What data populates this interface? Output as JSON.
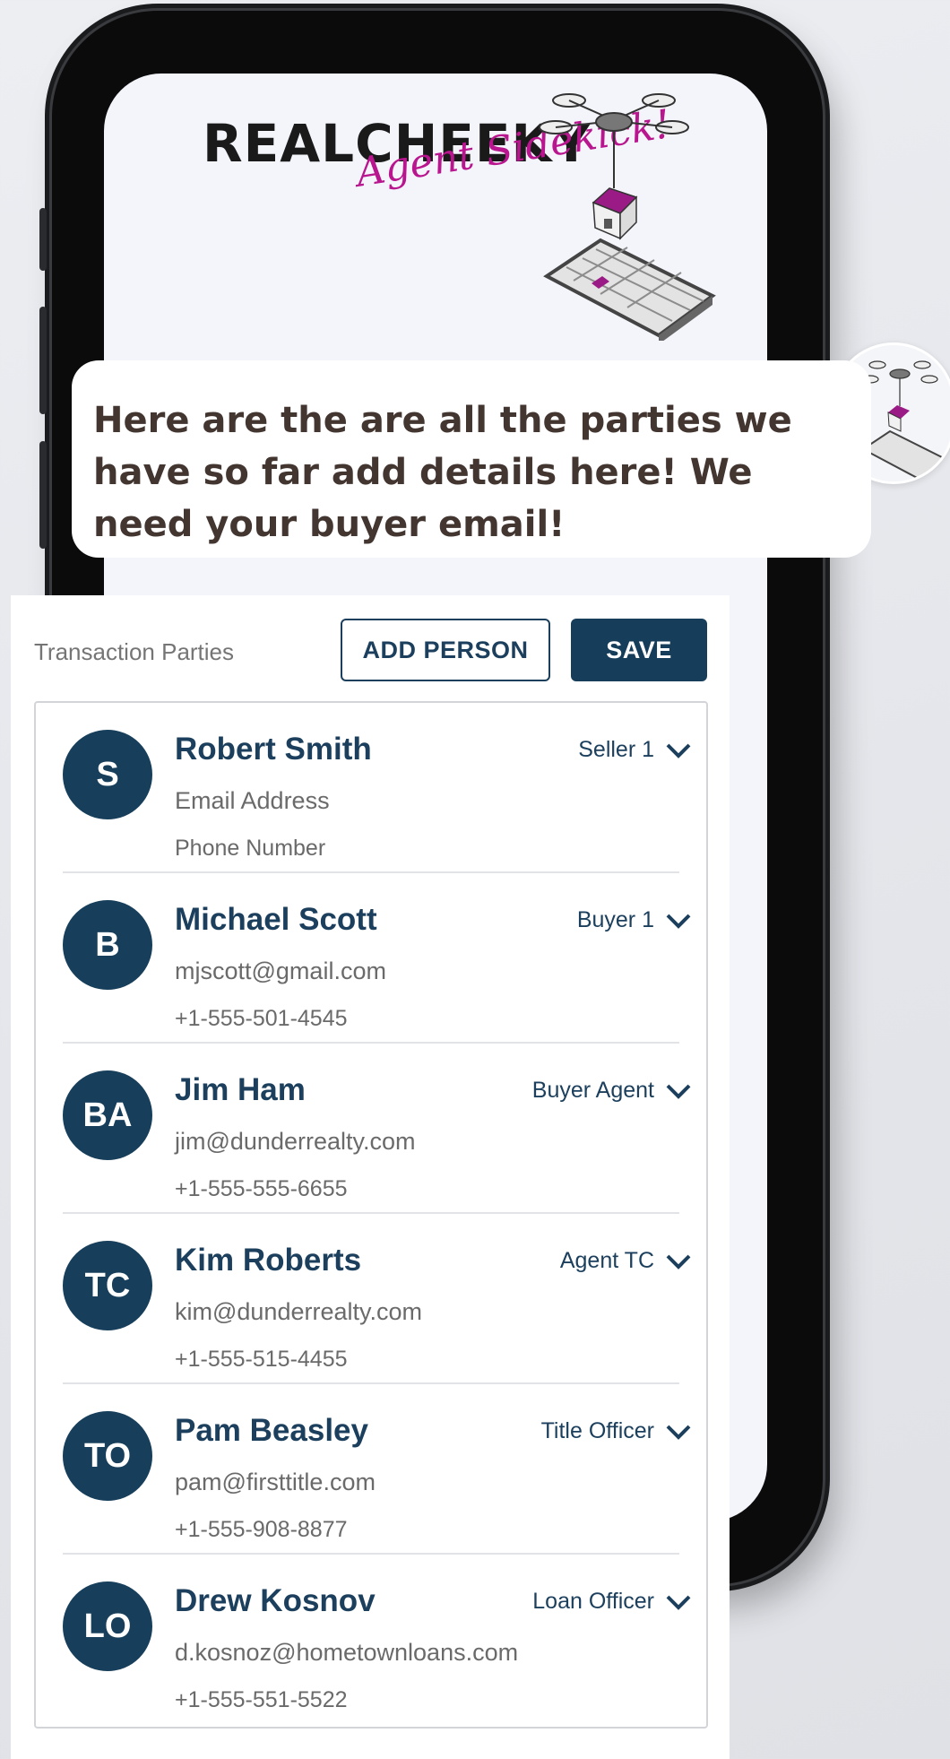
{
  "brand": {
    "wordmark": "REALCHEEKY",
    "tagline": "Agent Sidekick!"
  },
  "message": {
    "text": "Here are the are all the parties we have so far add details here! We need your buyer email!"
  },
  "panel": {
    "title": "Transaction Parties",
    "add_label": "ADD PERSON",
    "save_label": "SAVE"
  },
  "parties": [
    {
      "initials": "S",
      "name": "Robert Smith",
      "role": "Seller 1",
      "email": "Email Address",
      "phone": "Phone Number"
    },
    {
      "initials": "B",
      "name": "Michael Scott",
      "role": "Buyer 1",
      "email": "mjscott@gmail.com",
      "phone": "+1-555-501-4545"
    },
    {
      "initials": "BA",
      "name": "Jim Ham",
      "role": "Buyer Agent",
      "email": "jim@dunderrealty.com",
      "phone": "+1-555-555-6655"
    },
    {
      "initials": "TC",
      "name": "Kim Roberts",
      "role": "Agent TC",
      "email": "kim@dunderrealty.com",
      "phone": "+1-555-515-4455"
    },
    {
      "initials": "TO",
      "name": "Pam Beasley",
      "role": "Title Officer",
      "email": "pam@firsttitle.com",
      "phone": "+1-555-908-8877"
    },
    {
      "initials": "LO",
      "name": "Drew Kosnov",
      "role": "Loan Officer",
      "email": "d.kosnoz@hometownloans.com",
      "phone": "+1-555-551-5522"
    }
  ],
  "icons": {
    "role_dropdown": "chevron-down-icon",
    "mascot": "drone-house-icon"
  },
  "colors": {
    "primary": "#163d5a",
    "brand_magenta": "#b8158f",
    "message_text": "#433530"
  }
}
